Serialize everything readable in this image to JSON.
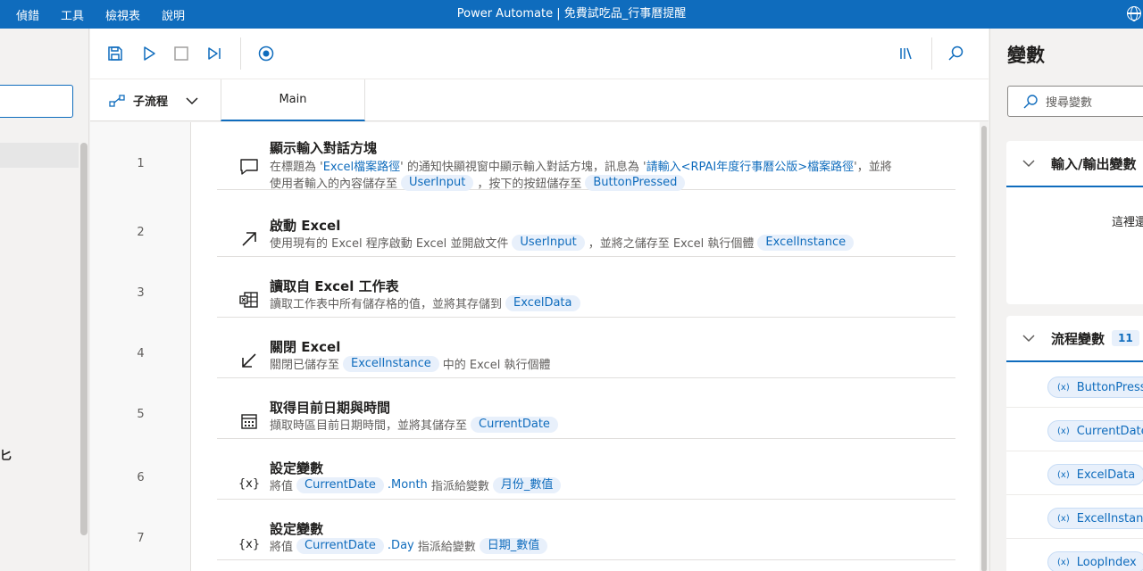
{
  "menu": [
    "偵錯",
    "工具",
    "檢視表",
    "說明"
  ],
  "app_title": "Power Automate | 免費試吃品_行事曆提醒",
  "left": {
    "cutoff_text": "匕"
  },
  "tabs": {
    "subflow_label": "子流程",
    "main_label": "Main"
  },
  "steps": [
    {
      "num": "1",
      "icon": "message-icon",
      "title": "顯示輸入對話方塊",
      "line1": {
        "pre": "在標題為 '",
        "v1": "Excel檔案路徑",
        "mid": "' 的通知快顯視窗中顯示輸入對話方塊，訊息為 '",
        "v2": "請輸入<RPAI年度行事曆公版>檔案路徑",
        "post": "'，並將"
      },
      "line2": {
        "a": "使用者輸入的內容儲存至",
        "p1": "UserInput",
        "b": "，按下的按鈕儲存至",
        "p2": "ButtonPressed"
      }
    },
    {
      "num": "2",
      "icon": "launch-arrow-icon",
      "title": "啟動 Excel",
      "desc": {
        "a": "使用現有的 Excel 程序啟動 Excel 並開啟文件",
        "p1": "UserInput",
        "b": "，並將之儲存至 Excel 執行個體",
        "p2": "ExcelInstance"
      }
    },
    {
      "num": "3",
      "icon": "excel-read-icon",
      "title": "讀取自 Excel 工作表",
      "desc": {
        "a": "讀取工作表中所有儲存格的值，並將其存儲到",
        "p1": "ExcelData"
      }
    },
    {
      "num": "4",
      "icon": "close-arrow-icon",
      "title": "關閉 Excel",
      "desc": {
        "a": "關閉已儲存至",
        "p1": "ExcelInstance",
        "b": "中的 Excel 執行個體"
      }
    },
    {
      "num": "5",
      "icon": "calendar-icon",
      "title": "取得目前日期與時間",
      "desc": {
        "a": "擷取時區目前日期時間，並將其儲存至",
        "p1": "CurrentDate"
      }
    },
    {
      "num": "6",
      "icon": "variable-icon",
      "icon_text": "{x}",
      "title": "設定變數",
      "desc": {
        "a": "將值",
        "p1": "CurrentDate",
        "b": ".Month",
        "c": "指派給變數",
        "p2": "月份_數值"
      }
    },
    {
      "num": "7",
      "icon": "variable-icon",
      "icon_text": "{x}",
      "title": "設定變數",
      "desc": {
        "a": "將值",
        "p1": "CurrentDate",
        "b": ".Day",
        "c": "指派給變數",
        "p2": "日期_數值"
      }
    }
  ],
  "variables": {
    "title": "變數",
    "search_placeholder": "搜尋變數",
    "io_section": {
      "title": "輸入/輸出變數",
      "empty_text": "這裡還"
    },
    "flow_section": {
      "title": "流程變數",
      "count": "11"
    },
    "chip_prefix": "(x)",
    "items": [
      "ButtonPressed",
      "CurrentDate",
      "ExcelData",
      "ExcelInstance",
      "LoopIndex"
    ]
  },
  "colors": {
    "accent": "#0f6cbd",
    "pill_bg": "#e8f0fb"
  }
}
